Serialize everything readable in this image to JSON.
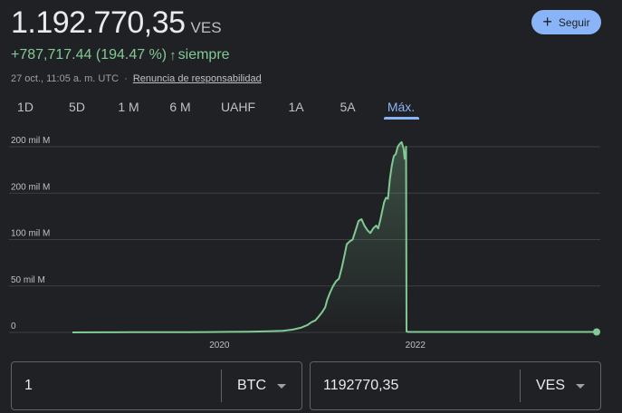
{
  "quote": {
    "price": "1.192.770,35",
    "currency": "VES",
    "change": "+787,717.44 (194.47 %)",
    "change_arrow": "↑",
    "change_period": "siempre",
    "timestamp": "27 oct., 11:05 a. m. UTC",
    "separator": "·",
    "disclaimer": "Renuncia de responsabilidad"
  },
  "follow_button": {
    "label": "Seguir",
    "icon": "plus-icon"
  },
  "tabs": [
    {
      "label": "1D"
    },
    {
      "label": "5D"
    },
    {
      "label": "1 M"
    },
    {
      "label": "6 M"
    },
    {
      "label": "UAHF"
    },
    {
      "label": "1A"
    },
    {
      "label": "5A"
    },
    {
      "label": "Máx.",
      "active": true
    }
  ],
  "converter": {
    "from": {
      "amount": "1",
      "unit": "BTC"
    },
    "to": {
      "amount": "1192770,35",
      "unit": "VES"
    }
  },
  "colors": {
    "line": "#81c995",
    "accent": "#8ab4f8",
    "background": "#202124",
    "grid": "#3c4043"
  },
  "chart_data": {
    "type": "area",
    "title": "",
    "xlabel": "",
    "ylabel": "",
    "y_tick_labels": [
      "0",
      "50 mil M",
      "100 mil M",
      "200 mil M",
      "200 mil M"
    ],
    "y_tick_values": [
      0,
      50,
      100,
      150,
      200
    ],
    "x_tick_labels": [
      {
        "label": "2020",
        "value": 2020.0
      },
      {
        "label": "2022",
        "value": 2022.0
      }
    ],
    "xlim": [
      2018.5,
      2023.85
    ],
    "ylim": [
      0,
      200
    ],
    "y_unit": "mil M VES",
    "grid": true,
    "legend": "none",
    "series": [
      {
        "x": [
          2018.5,
          2018.8,
          2019.1,
          2019.4,
          2019.7,
          2019.9,
          2020.1,
          2020.3,
          2020.5,
          2020.65,
          2020.75,
          2020.83,
          2020.9,
          2020.94,
          2020.98,
          2021.02,
          2021.05,
          2021.08,
          2021.1,
          2021.13,
          2021.16,
          2021.19,
          2021.22,
          2021.25,
          2021.28,
          2021.3,
          2021.33,
          2021.36,
          2021.39,
          2021.42,
          2021.45,
          2021.48,
          2021.51,
          2021.54,
          2021.57,
          2021.6,
          2021.62,
          2021.64,
          2021.66,
          2021.68,
          2021.7,
          2021.72,
          2021.74,
          2021.76,
          2021.78,
          2021.8,
          2021.82,
          2021.84,
          2021.86,
          2021.88,
          2021.89,
          2021.9,
          2021.905,
          2021.91,
          2021.93,
          2021.95,
          2021.97,
          2022.0,
          2022.5,
          2023.0,
          2023.5,
          2023.85
        ],
        "y": [
          0.0,
          0.1,
          0.2,
          0.2,
          0.3,
          0.4,
          0.6,
          0.8,
          1.2,
          1.8,
          3,
          5,
          8,
          11,
          13,
          18,
          22,
          27,
          35,
          43,
          50,
          55,
          58,
          70,
          85,
          95,
          98,
          100,
          110,
          120,
          122,
          115,
          110,
          107,
          112,
          115,
          112,
          120,
          130,
          140,
          145,
          144,
          165,
          180,
          190,
          192,
          200,
          203,
          205,
          198,
          187,
          192,
          200,
          1,
          0.5,
          0.5,
          0.5,
          0.5,
          0.5,
          0.5,
          0.5,
          0.5
        ]
      }
    ]
  }
}
